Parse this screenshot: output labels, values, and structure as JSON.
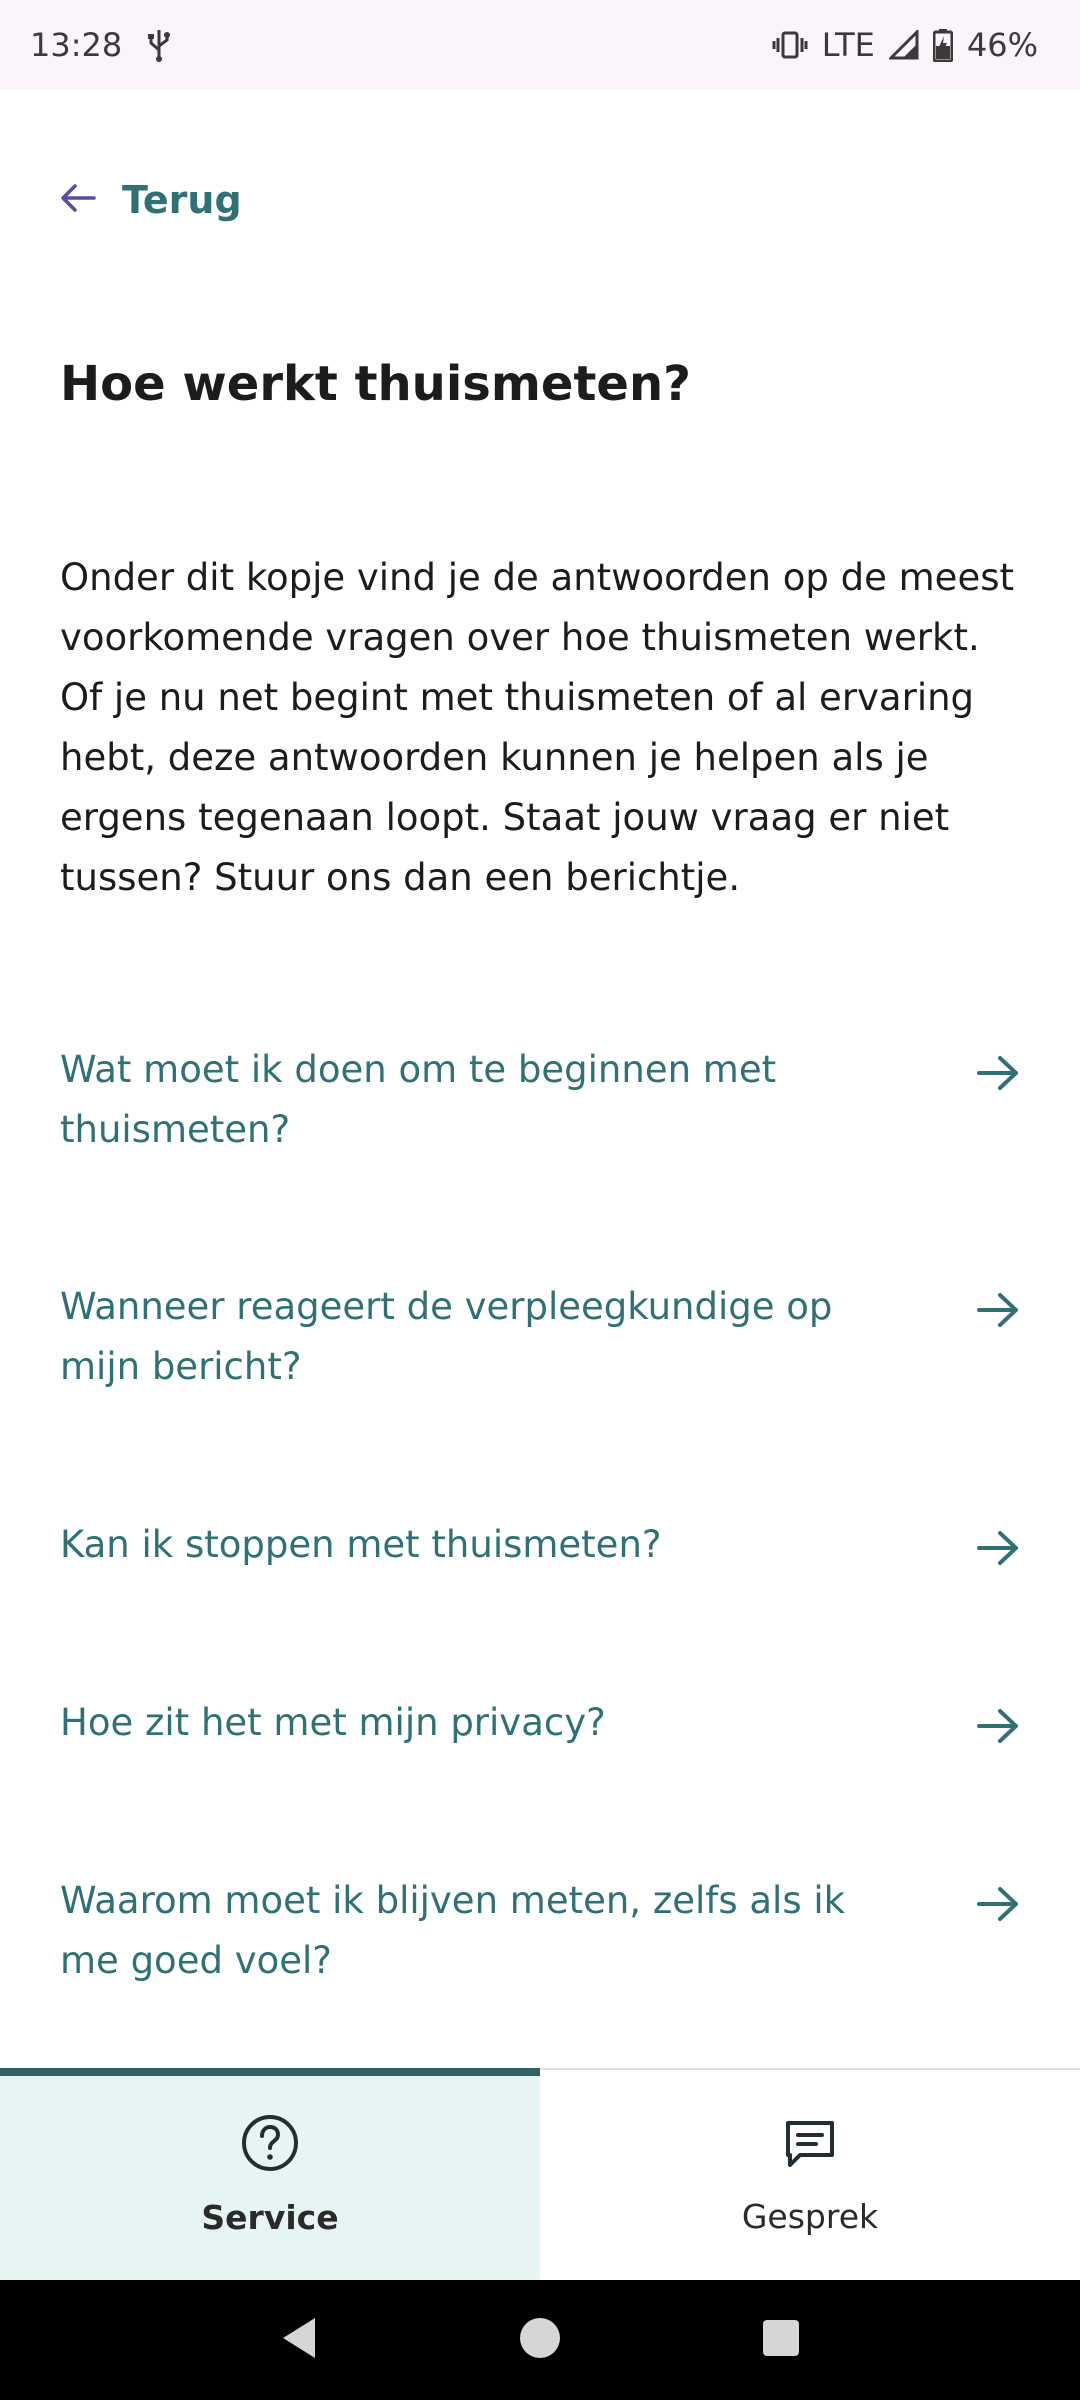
{
  "status_bar": {
    "time": "13:28",
    "network": "LTE",
    "battery": "46%",
    "icons": [
      "usb-icon",
      "vibrate-icon",
      "signal-icon",
      "battery-icon"
    ]
  },
  "back": {
    "label": "Terug",
    "icon": "arrow-left-icon"
  },
  "title": "Hoe werkt thuismeten?",
  "intro": "Onder dit kopje vind je de antwoorden op de meest voorkomende vragen over hoe thuismeten werkt. Of je nu net begint met thuismeten of al ervaring hebt, deze antwoorden kunnen je helpen als je ergens tegenaan loopt. Staat jouw vraag er niet tussen? Stuur ons dan een berichtje.",
  "faq": [
    {
      "question": "Wat moet ik doen om te beginnen met thuismeten?"
    },
    {
      "question": "Wanneer reageert de verpleegkundige op mijn bericht?"
    },
    {
      "question": "Kan ik stoppen met thuismeten?"
    },
    {
      "question": "Hoe zit het met mijn privacy?"
    },
    {
      "question": "Waarom moet ik blijven meten, zelfs als ik me goed voel?"
    }
  ],
  "bottom_nav": {
    "tabs": [
      {
        "label": "Service",
        "icon": "help-circle-icon",
        "active": true
      },
      {
        "label": "Gesprek",
        "icon": "chat-icon",
        "active": false
      }
    ]
  },
  "colors": {
    "accent": "#2f7175",
    "active_tab_bg": "#e7f4f4",
    "status_bar_bg": "#fbf4fb"
  }
}
